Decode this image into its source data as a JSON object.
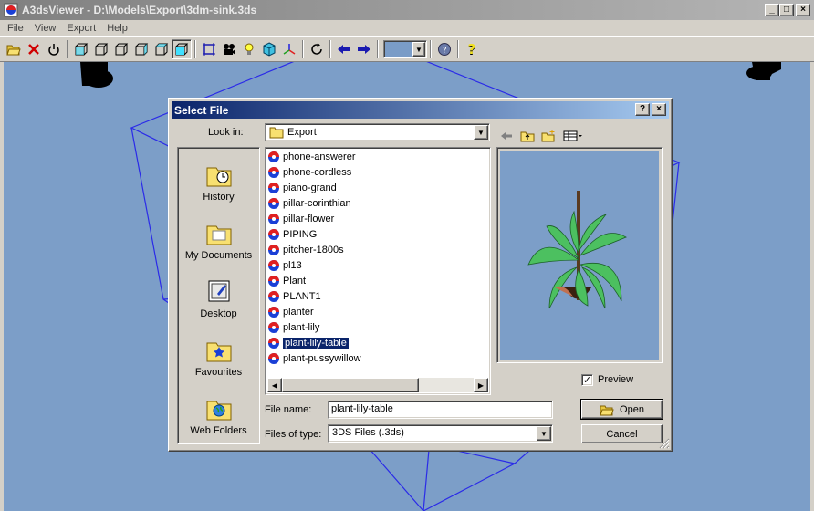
{
  "window": {
    "title": "A3dsViewer - D:\\Models\\Export\\3dm-sink.3ds",
    "minimize": "_",
    "maximize": "□",
    "close": "×"
  },
  "menu": [
    "File",
    "View",
    "Export",
    "Help"
  ],
  "toolbar": {
    "buttons": [
      "open-icon",
      "delete-icon",
      "power-icon",
      "cube-front-icon",
      "cube-back-icon",
      "cube-left-icon",
      "cube-right-icon",
      "cube-top-icon",
      "cube-bottom-icon",
      "bounding-box-icon",
      "camera-icon",
      "light-bulb-icon",
      "solid-cube-icon",
      "axes-icon",
      "rotate-icon",
      "arrow-left-icon",
      "arrow-right-icon",
      "color-picker",
      "help-icon",
      "what-is-this-icon"
    ],
    "color_swatch": "#7a9cc7"
  },
  "colors": {
    "viewport_bg": "#7c9ec8",
    "wireframe": "#2a2ae8",
    "dialog_title_start": "#0a246a",
    "dialog_title_end": "#a6caf0",
    "selection": "#0a246a"
  },
  "dialog": {
    "title": "Select File",
    "help_btn": "?",
    "close_btn": "×",
    "look_in_label": "Look in:",
    "look_in_value": "Export",
    "places": [
      "History",
      "My Documents",
      "Desktop",
      "Favourites",
      "Web Folders"
    ],
    "files": [
      "phone-answerer",
      "phone-cordless",
      "piano-grand",
      "pillar-corinthian",
      "pillar-flower",
      "PIPING",
      "pitcher-1800s",
      "pl13",
      "Plant",
      "PLANT1",
      "planter",
      "plant-lily",
      "plant-lily-table",
      "plant-pussywillow"
    ],
    "selected_file": "plant-lily-table",
    "preview_label": "Preview",
    "preview_checked": true,
    "file_name_label": "File name:",
    "file_name_value": "plant-lily-table",
    "file_type_label": "Files of type:",
    "file_type_value": "3DS Files (.3ds)",
    "open_label": "Open",
    "cancel_label": "Cancel"
  }
}
